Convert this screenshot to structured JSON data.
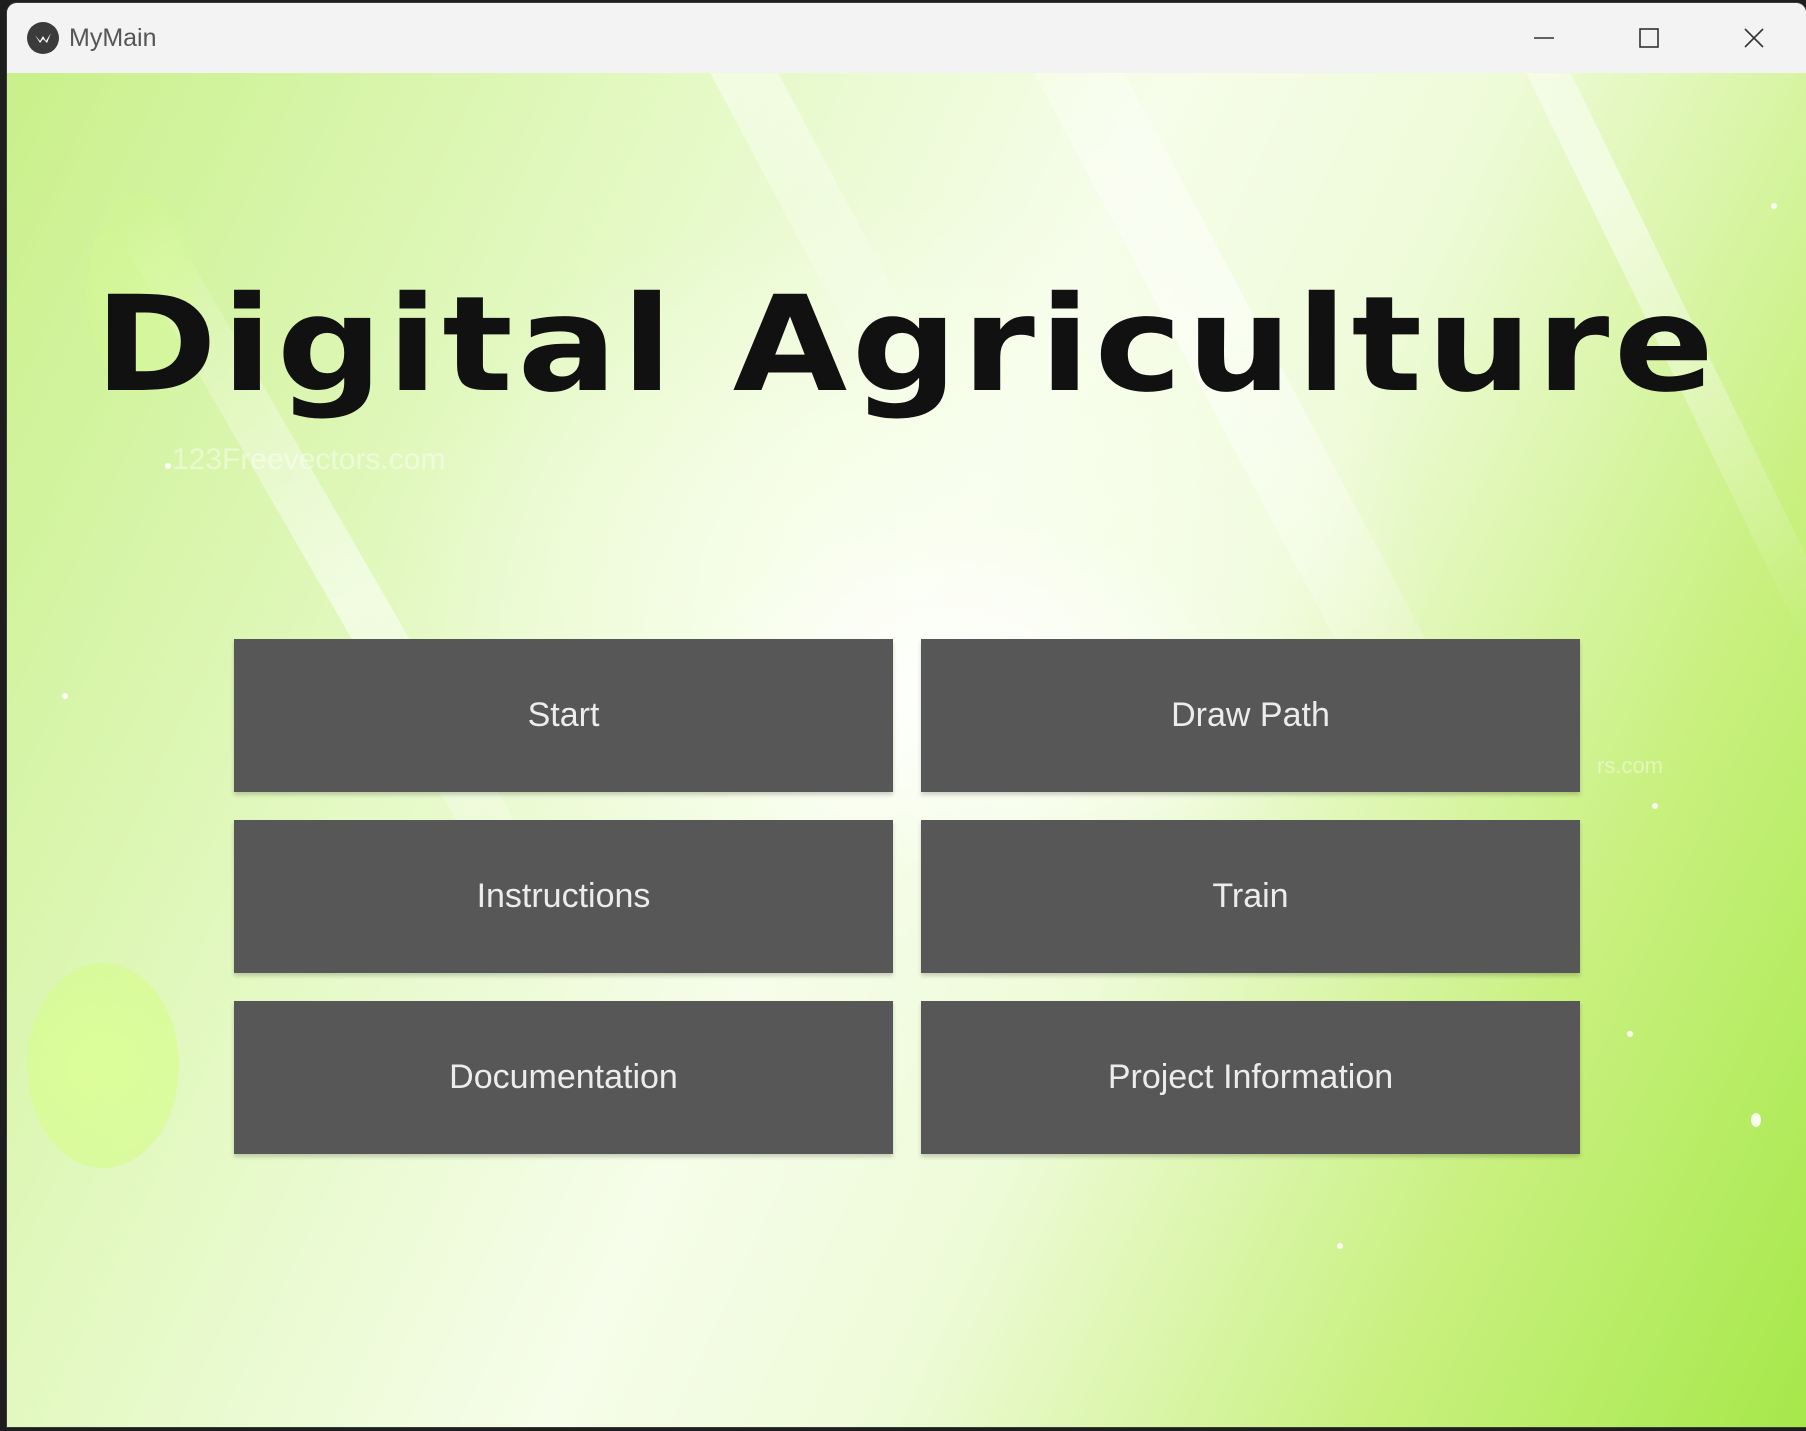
{
  "window": {
    "title": "MyMain",
    "app_icon": "kivy-logo-icon",
    "controls": [
      {
        "name": "minimize-button",
        "icon": "minimize-icon"
      },
      {
        "name": "maximize-button",
        "icon": "maximize-icon"
      },
      {
        "name": "close-button",
        "icon": "close-icon"
      }
    ]
  },
  "main": {
    "title": "Digital Agriculture",
    "watermark": "123Freevectors.com",
    "watermark_partial": "rs.com",
    "buttons": {
      "start": "Start",
      "draw_path": "Draw Path",
      "instructions": "Instructions",
      "train": "Train",
      "documentation": "Documentation",
      "project_information": "Project Information"
    }
  },
  "colors": {
    "button_bg": "#575757",
    "button_text": "#ececec",
    "title_text": "#111111",
    "background_accent": "#a6e84a"
  }
}
